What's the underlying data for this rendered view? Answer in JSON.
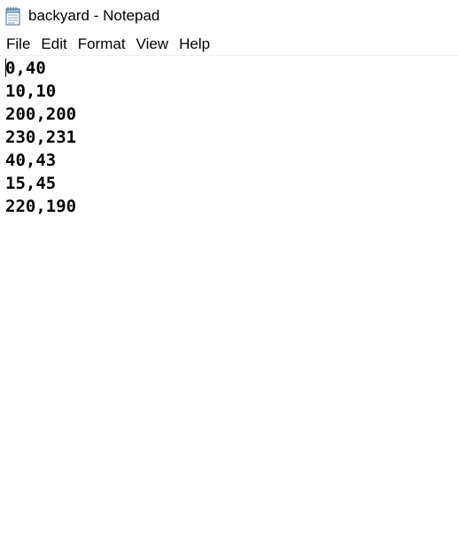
{
  "window": {
    "title": "backyard - Notepad",
    "app_icon": "notepad-icon"
  },
  "menu": {
    "items": [
      "File",
      "Edit",
      "Format",
      "View",
      "Help"
    ]
  },
  "document": {
    "lines": [
      "0,40",
      "10,10",
      "200,200",
      "230,231",
      "40,43",
      "15,45",
      "220,190"
    ]
  }
}
